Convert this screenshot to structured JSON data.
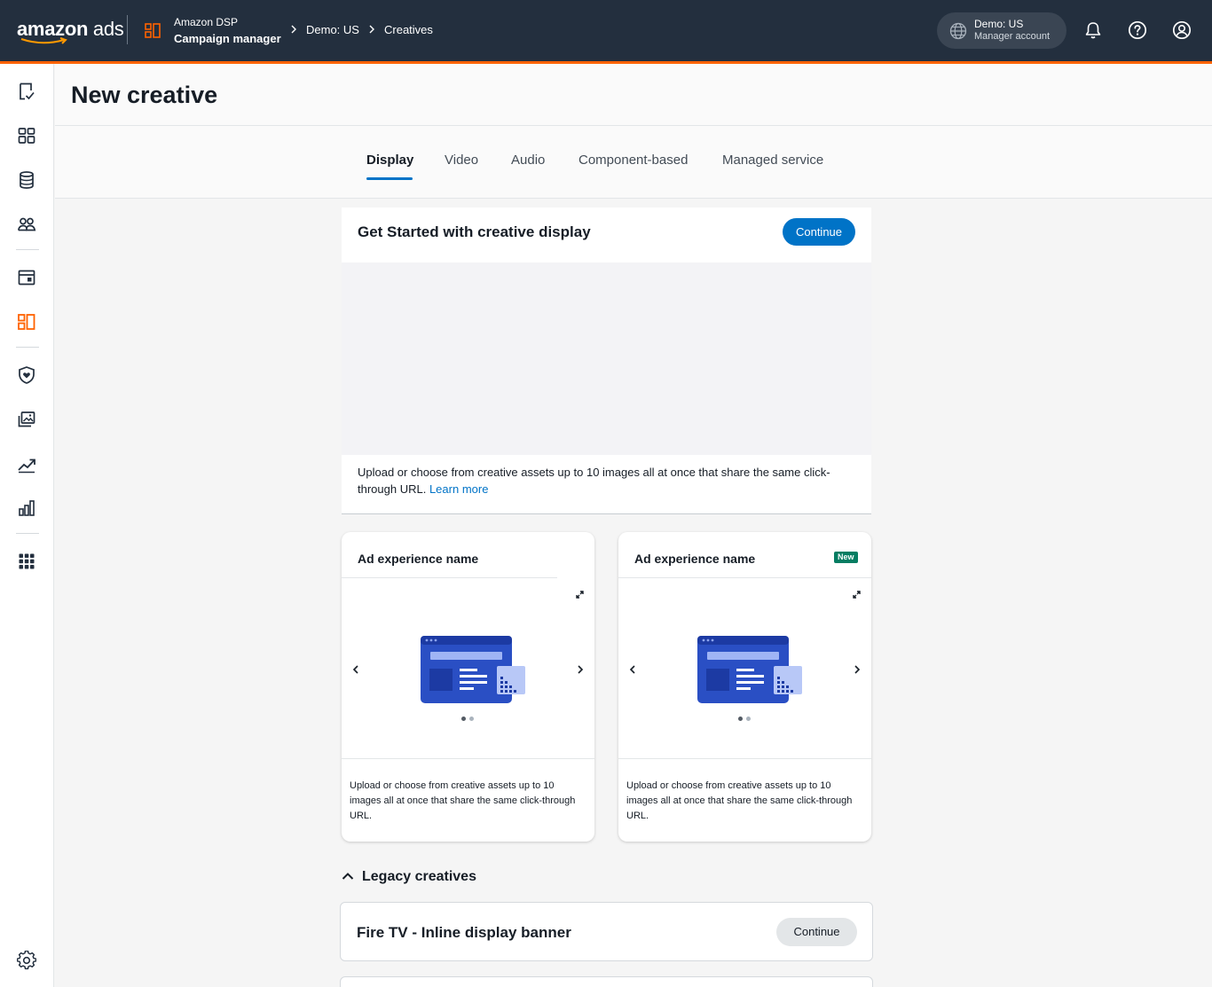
{
  "header": {
    "logo_text_bold": "amazon",
    "logo_text_light": "ads",
    "app_product": "Amazon DSP",
    "app_name": "Campaign manager",
    "breadcrumb": [
      "Demo: US",
      "Creatives"
    ],
    "account_name": "Demo: US",
    "account_type": "Manager account",
    "accent_color": "#ff6200",
    "bar_color": "#232f3e"
  },
  "sidebar": {
    "items": [
      {
        "icon": "checklist-icon"
      },
      {
        "icon": "dashboard-icon"
      },
      {
        "icon": "database-icon"
      },
      {
        "icon": "audience-icon"
      },
      {
        "icon": "browser-window-icon"
      },
      {
        "icon": "creatives-icon",
        "active": true
      },
      {
        "icon": "shield-heart-icon"
      },
      {
        "icon": "image-library-icon"
      },
      {
        "icon": "trending-icon"
      },
      {
        "icon": "bar-chart-icon"
      },
      {
        "icon": "apps-grid-icon"
      },
      {
        "icon": "settings-gear-icon"
      }
    ]
  },
  "page": {
    "title": "New creative",
    "tabs": [
      "Display",
      "Video",
      "Audio",
      "Component-based",
      "Managed service"
    ],
    "active_tab": "Display"
  },
  "get_started": {
    "title": "Get Started with creative display",
    "button": "Continue",
    "description": "Upload or choose from creative assets up to 10 images all at once that share the same click-through URL.",
    "link": "Learn more"
  },
  "ad_experiences": [
    {
      "title": "Ad experience name",
      "badge": "",
      "description": "Upload or choose from creative assets up to 10 images all at once that share the same click-through URL."
    },
    {
      "title": "Ad experience name",
      "badge": "New",
      "description": "Upload or choose from creative assets up to 10 images all at once that share the same click-through URL."
    }
  ],
  "legacy": {
    "heading": "Legacy creatives",
    "items": [
      {
        "title": "Fire TV - Inline display banner",
        "button": "Continue"
      }
    ]
  }
}
